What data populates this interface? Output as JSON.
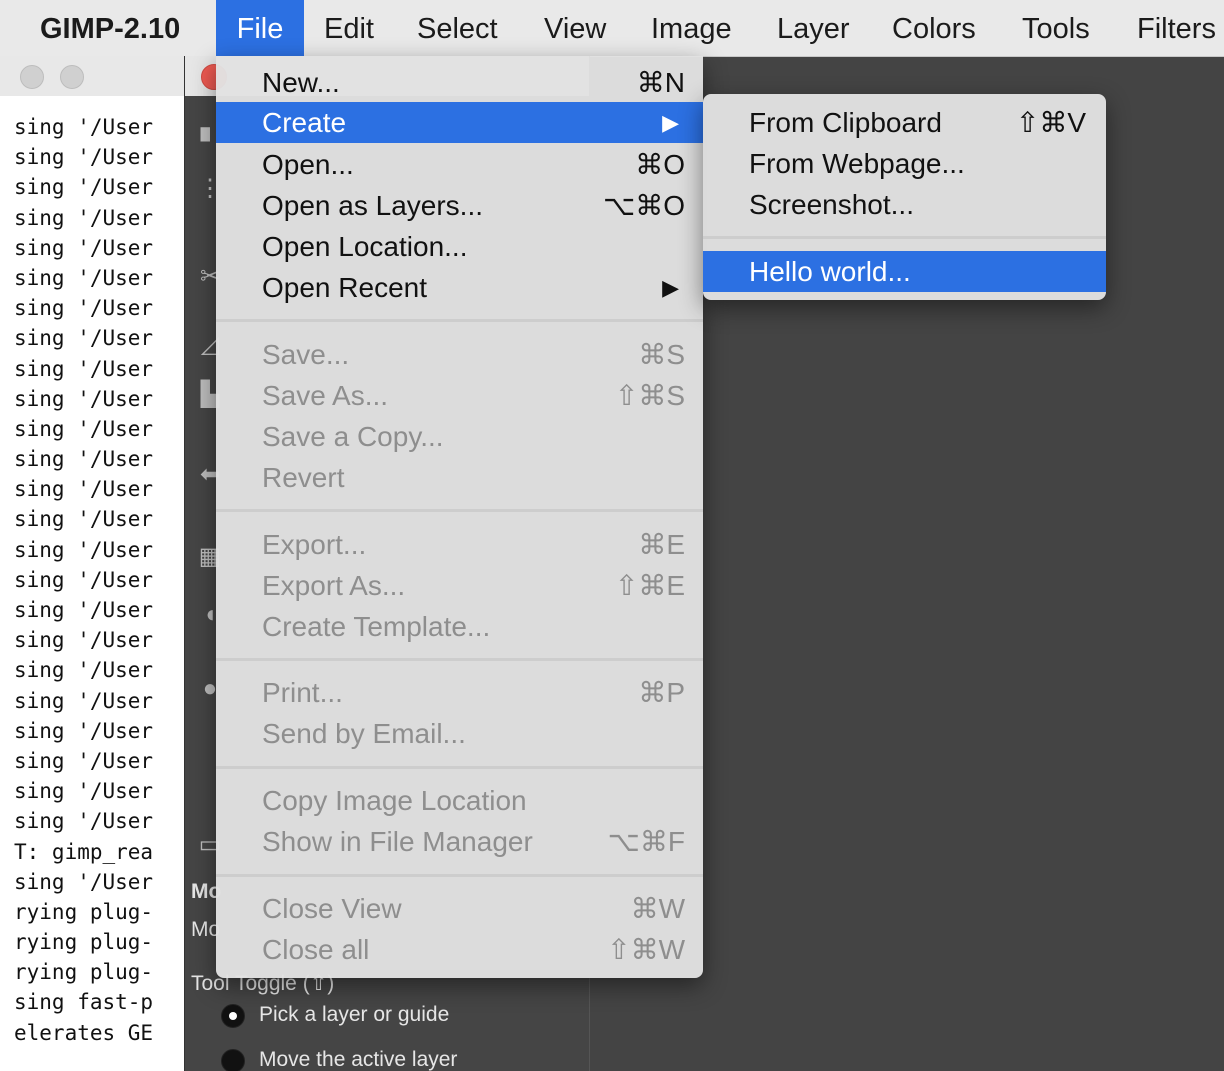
{
  "menubar": {
    "app_name": "GIMP-2.10",
    "items": [
      "File",
      "Edit",
      "Select",
      "View",
      "Image",
      "Layer",
      "Colors",
      "Tools",
      "Filters"
    ]
  },
  "terminal": {
    "lines": [
      "sing '/User",
      "sing '/User",
      "sing '/User",
      "sing '/User",
      "sing '/User",
      "sing '/User",
      "sing '/User",
      "sing '/User",
      "sing '/User",
      "sing '/User",
      "sing '/User",
      "sing '/User",
      "sing '/User",
      "sing '/User",
      "sing '/User",
      "sing '/User",
      "sing '/User",
      "sing '/User",
      "sing '/User",
      "sing '/User",
      "sing '/User",
      "sing '/User",
      "sing '/User",
      "sing '/User",
      "T: gimp_rea",
      "sing '/User",
      "rying plug-",
      "rying plug-",
      "rying plug-",
      "sing fast-p",
      "elerates GE"
    ]
  },
  "tool_options": {
    "mode_label_1": "Mo",
    "mode_label_2": "Mo",
    "tool_toggle_label": "Tool Toggle  (⇧)",
    "radio_pick": "Pick a layer or guide",
    "radio_move": "Move the active layer"
  },
  "file_menu": {
    "items": [
      {
        "label": "New...",
        "shortcut": "⌘N",
        "disabled": false
      },
      {
        "label": "Create",
        "submenu": true,
        "highlighted": true
      },
      {
        "label": "Open...",
        "shortcut": "⌘O",
        "disabled": false
      },
      {
        "label": "Open as Layers...",
        "shortcut": "⌥⌘O",
        "disabled": false
      },
      {
        "label": "Open Location...",
        "shortcut": "",
        "disabled": false
      },
      {
        "label": "Open Recent",
        "submenu": true
      },
      {
        "label": "Save...",
        "shortcut": "⌘S",
        "disabled": true
      },
      {
        "label": "Save As...",
        "shortcut": "⇧⌘S",
        "disabled": true
      },
      {
        "label": "Save a Copy...",
        "shortcut": "",
        "disabled": true
      },
      {
        "label": "Revert",
        "shortcut": "",
        "disabled": true
      },
      {
        "label": "Export...",
        "shortcut": "⌘E",
        "disabled": true
      },
      {
        "label": "Export As...",
        "shortcut": "⇧⌘E",
        "disabled": true
      },
      {
        "label": "Create Template...",
        "shortcut": "",
        "disabled": true
      },
      {
        "label": "Print...",
        "shortcut": "⌘P",
        "disabled": true
      },
      {
        "label": "Send by Email...",
        "shortcut": "",
        "disabled": true
      },
      {
        "label": "Copy Image Location",
        "shortcut": "",
        "disabled": true
      },
      {
        "label": "Show in File Manager",
        "shortcut": "⌥⌘F",
        "disabled": true
      },
      {
        "label": "Close View",
        "shortcut": "⌘W",
        "disabled": true
      },
      {
        "label": "Close all",
        "shortcut": "⇧⌘W",
        "disabled": true
      }
    ],
    "arrow_glyph": "▶"
  },
  "create_submenu": {
    "items": [
      {
        "label": "From Clipboard",
        "shortcut": "⇧⌘V"
      },
      {
        "label": "From Webpage...",
        "shortcut": ""
      },
      {
        "label": "Screenshot...",
        "shortcut": ""
      },
      {
        "label": "Hello world...",
        "shortcut": "",
        "highlighted": true
      }
    ]
  },
  "colors": {
    "highlight": "#2c70e2",
    "canvas_bg": "#444444",
    "menu_bg": "#e1e1e1",
    "disabled_text": "#8e8e8e"
  }
}
